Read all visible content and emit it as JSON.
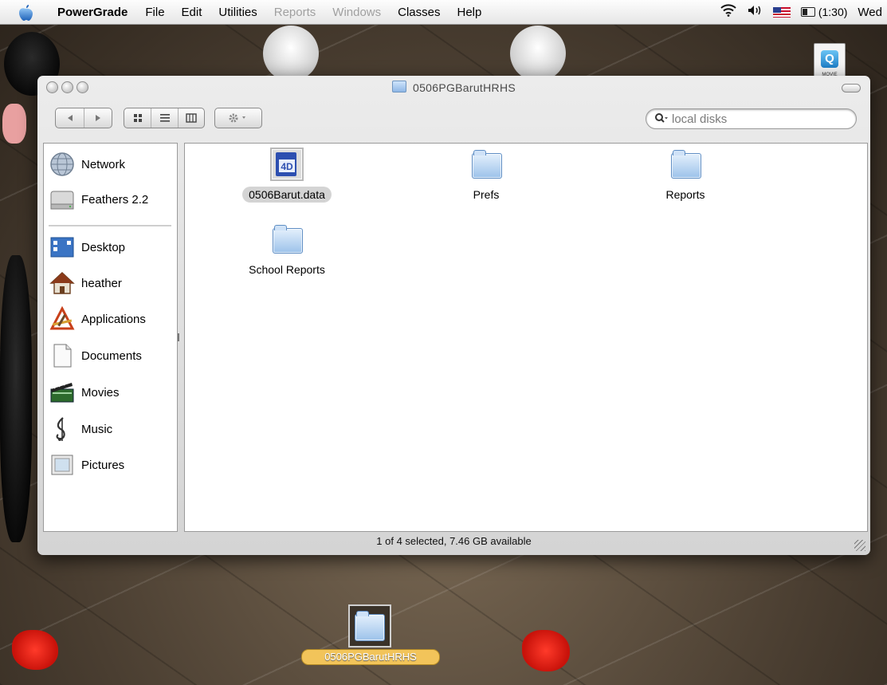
{
  "menubar": {
    "app_name": "PowerGrade",
    "items": [
      {
        "label": "File",
        "enabled": true
      },
      {
        "label": "Edit",
        "enabled": true
      },
      {
        "label": "Utilities",
        "enabled": true
      },
      {
        "label": "Reports",
        "enabled": false
      },
      {
        "label": "Windows",
        "enabled": false
      },
      {
        "label": "Classes",
        "enabled": true
      },
      {
        "label": "Help",
        "enabled": true
      }
    ],
    "battery_time": "(1:30)",
    "day": "Wed",
    "status_icons": [
      "wifi-icon",
      "volume-icon",
      "us-flag-icon",
      "battery-icon"
    ]
  },
  "window": {
    "title": "0506PGBarutHRHS",
    "search_placeholder": "local disks",
    "status": "1 of 4 selected, 7.46 GB available"
  },
  "sidebar": {
    "devices": [
      {
        "label": "Network",
        "icon": "network-globe-icon"
      },
      {
        "label": "Feathers 2.2",
        "icon": "hard-disk-icon"
      }
    ],
    "places": [
      {
        "label": "Desktop",
        "icon": "desktop-icon"
      },
      {
        "label": "heather",
        "icon": "home-icon"
      },
      {
        "label": "Applications",
        "icon": "applications-icon"
      },
      {
        "label": "Documents",
        "icon": "documents-icon"
      },
      {
        "label": "Movies",
        "icon": "movies-icon"
      },
      {
        "label": "Music",
        "icon": "music-icon"
      },
      {
        "label": "Pictures",
        "icon": "pictures-icon"
      }
    ]
  },
  "content": {
    "items": [
      {
        "name": "0506Barut.data",
        "icon": "4d-database-icon",
        "selected": true
      },
      {
        "name": "Prefs",
        "icon": "folder-icon",
        "selected": false
      },
      {
        "name": "Reports",
        "icon": "folder-icon",
        "selected": false
      },
      {
        "name": "School Reports",
        "icon": "folder-icon",
        "selected": false
      }
    ]
  },
  "desktop": {
    "folder_label": "0506PGBarutHRHS",
    "movie_file_badge": "MOVIE"
  },
  "colors": {
    "selection_pill": "#d4d4d4",
    "desktop_label_highlight": "#f2c45a",
    "folder_blue": "#9cc2ea"
  }
}
